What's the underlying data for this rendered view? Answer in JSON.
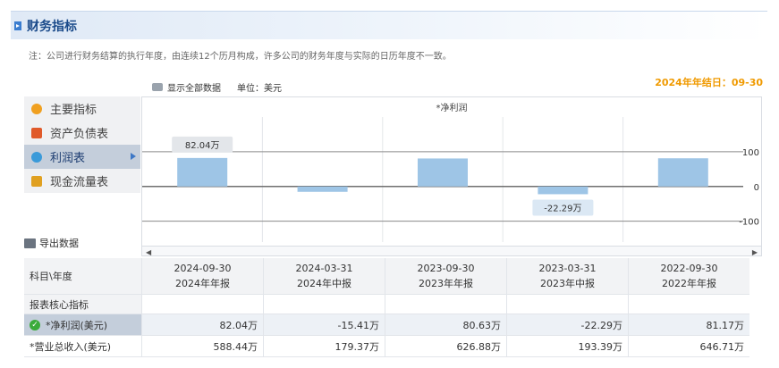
{
  "header": {
    "title": "财务指标"
  },
  "note": "注：公司进行财务结算的执行年度，由连续12个历月构成，许多公司的财务年度与实际的日历年度不一致。",
  "toolbar": {
    "show_all": "显示全部数据",
    "unit": "单位：美元"
  },
  "fiscal_year_end": "2024年年结日：09-30",
  "nav": {
    "items": [
      {
        "label": "主要指标",
        "icon": "sun-icon",
        "color": "#f0a020"
      },
      {
        "label": "资产负债表",
        "icon": "document-icon",
        "color": "#e05a2a"
      },
      {
        "label": "利润表",
        "icon": "globe-icon",
        "color": "#3a9ad9",
        "active": true
      },
      {
        "label": "现金流量表",
        "icon": "person-icon",
        "color": "#e0a020"
      }
    ],
    "export": "导出数据"
  },
  "chart_data": {
    "type": "bar",
    "title": "*净利润",
    "categories": [
      "2024-09-30",
      "2024-03-31",
      "2023-09-30",
      "2023-03-31",
      "2022-09-30"
    ],
    "values": [
      82.04,
      -15.41,
      80.63,
      -22.29,
      81.17
    ],
    "unit": "万",
    "yticks": [
      100,
      0,
      -100
    ],
    "ylim": [
      -160,
      200
    ],
    "grid": true,
    "annotations": [
      {
        "index": 0,
        "text": "82.04万"
      },
      {
        "index": 3,
        "text": "-22.29万"
      }
    ]
  },
  "table": {
    "header_label": "科目\\年度",
    "periods": [
      {
        "date": "2024-09-30",
        "label": "2024年年报"
      },
      {
        "date": "2024-03-31",
        "label": "2024年中报"
      },
      {
        "date": "2023-09-30",
        "label": "2023年年报"
      },
      {
        "date": "2023-03-31",
        "label": "2023年中报"
      },
      {
        "date": "2022-09-30",
        "label": "2022年年报"
      }
    ],
    "section": "报表核心指标",
    "rows": [
      {
        "label": "*净利润(美元)",
        "values": [
          "82.04万",
          "-15.41万",
          "80.63万",
          "-22.29万",
          "81.17万"
        ]
      },
      {
        "label": "*营业总收入(美元)",
        "values": [
          "588.44万",
          "179.37万",
          "626.88万",
          "193.39万",
          "646.71万"
        ]
      }
    ]
  },
  "colors": {
    "bar": "#9ec5e6",
    "accent": "#f09a00",
    "nav_active": "#c4cedb"
  }
}
